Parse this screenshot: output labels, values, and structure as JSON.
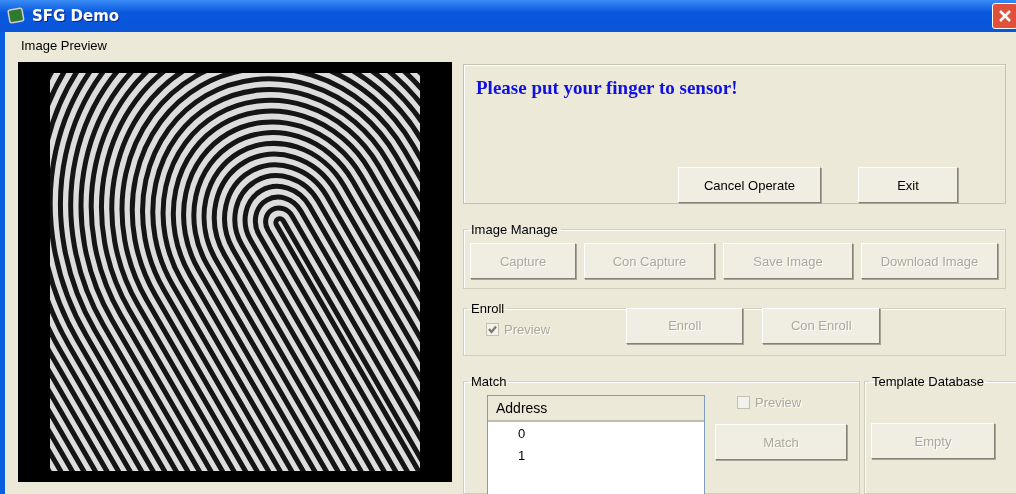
{
  "window": {
    "title": "SFG Demo"
  },
  "image_preview": {
    "label": "Image Preview"
  },
  "message": {
    "text": "Please put your finger to sensor!",
    "buttons": [
      {
        "label": "Cancel Operate",
        "disabled": false
      },
      {
        "label": "Exit",
        "disabled": false
      }
    ]
  },
  "image_manage": {
    "title": "Image Manage",
    "buttons": [
      {
        "label": "Capture",
        "disabled": true
      },
      {
        "label": "Con Capture",
        "disabled": true
      },
      {
        "label": "Save Image",
        "disabled": true
      },
      {
        "label": "Download Image",
        "disabled": true
      }
    ]
  },
  "enroll": {
    "title": "Enroll",
    "preview": {
      "label": "Preview",
      "checked": true,
      "disabled": true
    },
    "buttons": [
      {
        "label": "Enroll",
        "disabled": true
      },
      {
        "label": "Con Enroll",
        "disabled": true
      }
    ]
  },
  "match": {
    "title": "Match",
    "table": {
      "columns": [
        "Address"
      ],
      "rows": [
        "0",
        "1"
      ]
    },
    "preview": {
      "label": "Preview",
      "checked": false,
      "disabled": true
    },
    "buttons": [
      {
        "label": "Match",
        "disabled": true
      }
    ]
  },
  "template_database": {
    "title": "Template Database",
    "buttons": [
      {
        "label": "Empty",
        "disabled": true
      }
    ]
  }
}
